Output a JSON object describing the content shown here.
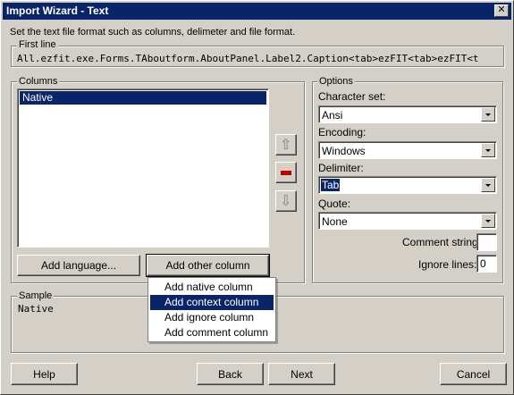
{
  "window": {
    "title": "Import Wizard - Text",
    "close_glyph": "✕"
  },
  "instruction": "Set the text file format such as columns, delimeter and file format.",
  "first_line": {
    "label": "First line",
    "text": "All.ezfit.exe.Forms.TAboutform.AboutPanel.Label2.Caption<tab>ezFIT<tab>ezFIT<t"
  },
  "columns": {
    "label": "Columns",
    "items": [
      "Native"
    ],
    "add_language_label": "Add language...",
    "add_other_column_label": "Add other column"
  },
  "side_buttons": {
    "up_glyph": "⇧",
    "down_glyph": "⇩"
  },
  "dropdown_menu": {
    "items": [
      "Add native column",
      "Add context column",
      "Add ignore column",
      "Add comment column"
    ],
    "highlighted_index": 1
  },
  "options": {
    "label": "Options",
    "character_set_label": "Character set:",
    "character_set_value": "Ansi",
    "encoding_label": "Encoding:",
    "encoding_value": "Windows",
    "delimiter_label": "Delimiter:",
    "delimiter_value": "Tab",
    "quote_label": "Quote:",
    "quote_value": "None",
    "comment_string_label": "Comment string:",
    "comment_string_value": "",
    "ignore_lines_label": "Ignore lines:",
    "ignore_lines_value": "0"
  },
  "sample": {
    "label": "Sample",
    "text": "Native"
  },
  "footer": {
    "help_label": "Help",
    "back_label": "Back",
    "next_label": "Next",
    "cancel_label": "Cancel"
  },
  "colors": {
    "titlebar": "#0a246a",
    "face": "#d4d0c8",
    "selection": "#0a246a",
    "remove_red": "#c00000"
  }
}
